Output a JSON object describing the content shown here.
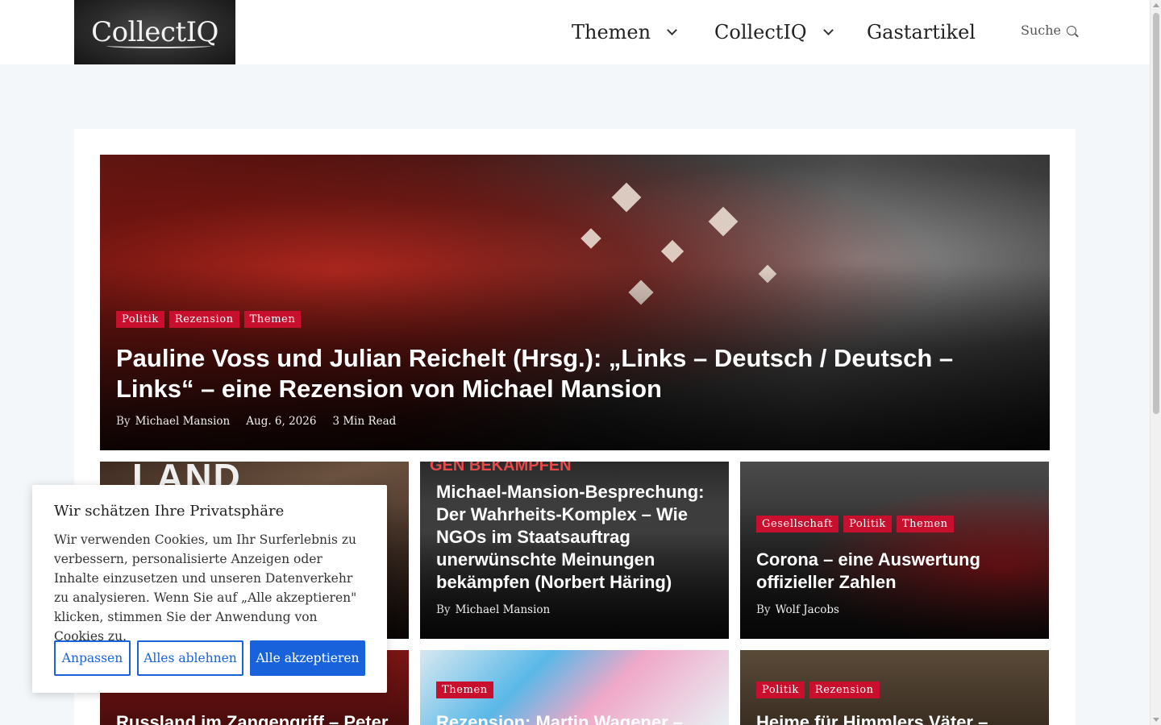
{
  "header": {
    "logo_text": "CollectIQ",
    "nav": [
      {
        "label": "Themen"
      },
      {
        "label": "CollectIQ"
      },
      {
        "label": "Gastartikel"
      }
    ],
    "search_label": "Suche"
  },
  "hero": {
    "tags": [
      "Politik",
      "Rezension",
      "Themen"
    ],
    "title": "Pauline Voss und Julian Reichelt (Hrsg.): „Links – Deutsch / Deutsch – Links“ – eine Rezension von Michael Mansion",
    "by": "By",
    "author": "Michael Mansion",
    "date": "Aug. 6, 2026",
    "read_time": "3 Min Read"
  },
  "cards": [
    {
      "tags": [],
      "title": "",
      "by": "",
      "author": "",
      "overlay": "LAND"
    },
    {
      "tags": [],
      "title": "Michael-Mansion-Besprechung: Der Wahrheits-Komplex – Wie NGOs im Staatsauftrag unerwünschte Meinungen bekämpfen (Norbert Häring)",
      "by": "By",
      "author": "Michael Mansion",
      "overlay": "GEN BEKÄMPFEN"
    },
    {
      "tags": [
        "Gesellschaft",
        "Politik",
        "Themen"
      ],
      "title": "Corona – eine Auswertung offizieller Zahlen",
      "by": "By",
      "author": "Wolf Jacobs"
    },
    {
      "tags": [],
      "title": "Russland im Zangengriff – Peter"
    },
    {
      "tags": [
        "Themen"
      ],
      "title": "Rezension: Martin Wagener –"
    },
    {
      "tags": [
        "Politik",
        "Rezension"
      ],
      "title": "Heime für Himmlers Väter –"
    }
  ],
  "cookie": {
    "title": "Wir schätzen Ihre Privatsphäre",
    "text": "Wir verwenden Cookies, um Ihr Surferlebnis zu verbessern, personalisierte Anzeigen oder Inhalte einzusetzen und unseren Datenverkehr zu analysieren. Wenn Sie auf „Alle akzeptieren\" klicken, stimmen Sie der Anwendung von Cookies zu.",
    "btn_customize": "Anpassen",
    "btn_reject": "Alles ablehnen",
    "btn_accept": "Alle akzeptieren"
  },
  "colors": {
    "tag": "#c8102e",
    "accent": "#1863dc"
  }
}
